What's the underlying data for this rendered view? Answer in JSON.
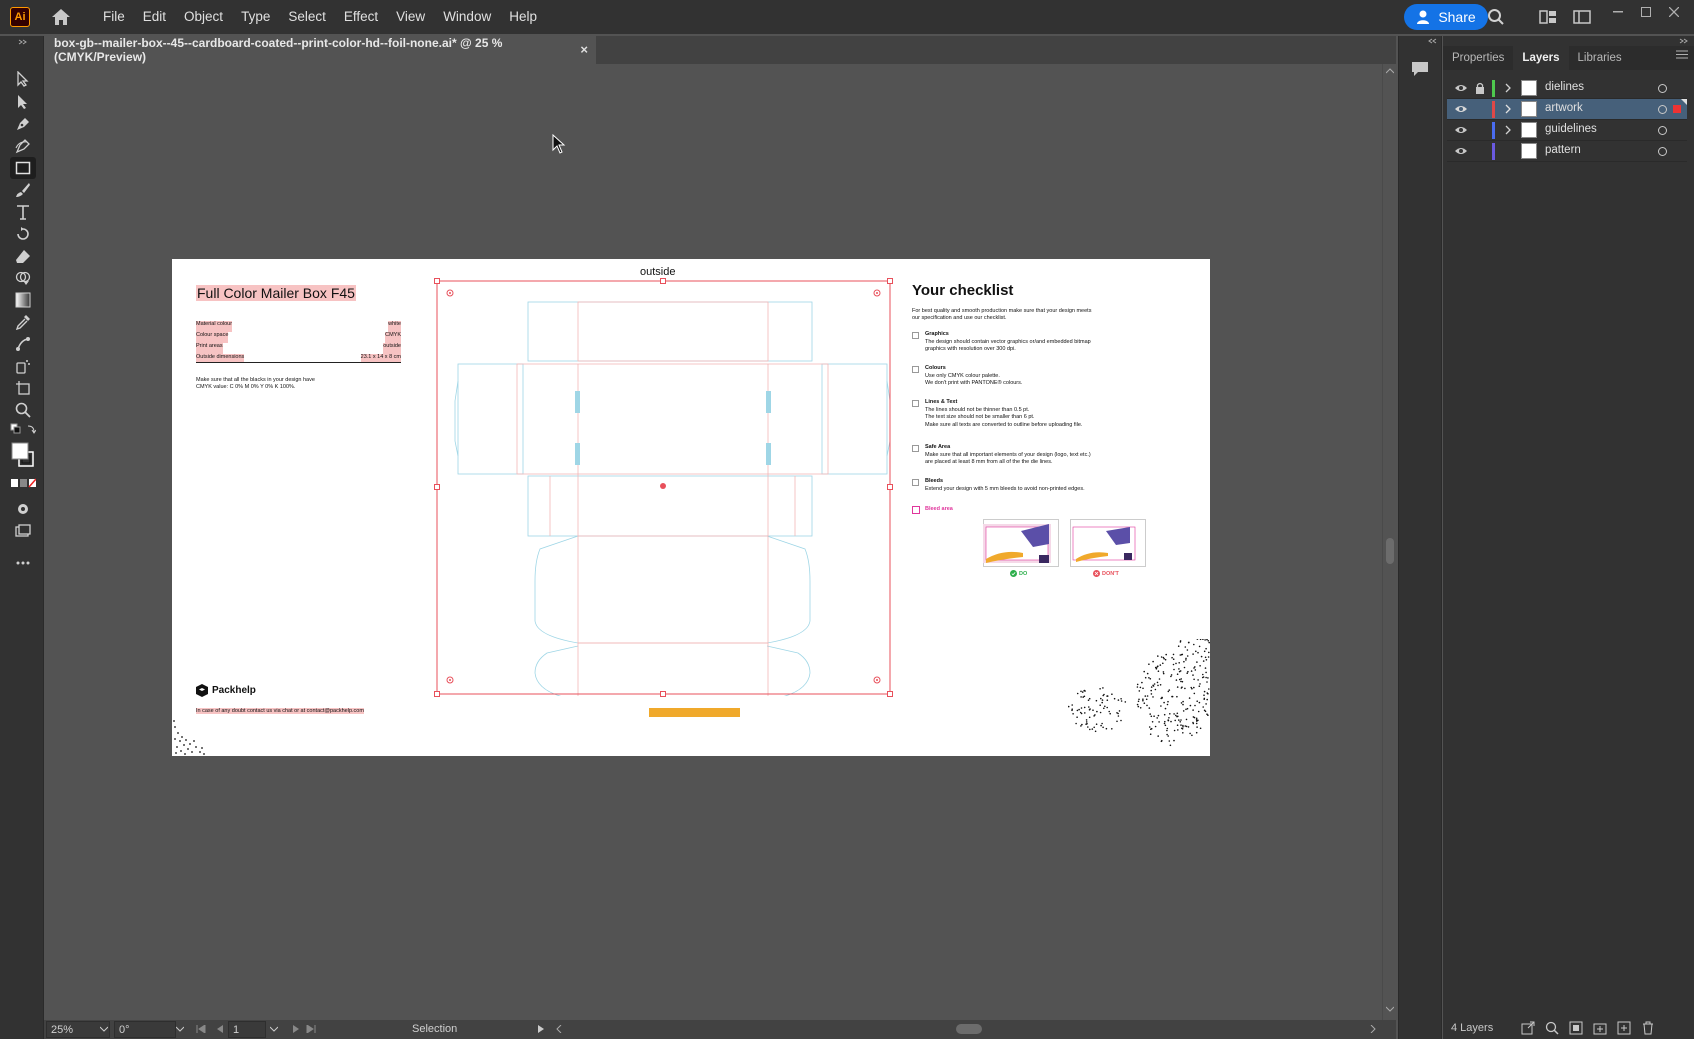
{
  "app": {
    "logo_label": "Ai",
    "menus": [
      "File",
      "Edit",
      "Object",
      "Type",
      "Select",
      "Effect",
      "View",
      "Window",
      "Help"
    ],
    "share_label": "Share"
  },
  "document": {
    "tab_title": "box-gb--mailer-box--45--cardboard-coated--print-color-hd--foil-none.ai* @ 25 % (CMYK/Preview)",
    "close_glyph": "×"
  },
  "artboard": {
    "side_label": "outside",
    "title": "Full Color Mailer Box F45",
    "specs": [
      {
        "key": "Material colour",
        "value": "white"
      },
      {
        "key": "Colour space",
        "value": "CMYK"
      },
      {
        "key": "Print areas",
        "value": "outside"
      },
      {
        "key": "Outside dimensions",
        "value": "23.1 x 14 x 8 cm"
      }
    ],
    "black_note_line1": "Make sure that all the blacks in your design have",
    "black_note_line2": "CMYK value: C 0% M 0% Y 0% K 100%.",
    "brand": "Packhelp",
    "contact": "In case of any doubt contact us via chat or at contact@packhelp.com",
    "checklist": {
      "heading": "Your checklist",
      "intro_line1": "For best quality and smooth production make sure that your design meets",
      "intro_line2": "our specification and use our checklist.",
      "items": [
        {
          "title": "Graphics",
          "lines": [
            "The design should contain vector graphics or/and embedded bitmap",
            "graphics with resolution over 300 dpi."
          ]
        },
        {
          "title": "Colours",
          "lines": [
            "Use only CMYK colour palette.",
            "We don't print with PANTONE® colours."
          ]
        },
        {
          "title": "Lines & Text",
          "lines": [
            "The lines should not be thinner than 0.5 pt.",
            "The text size should not be smaller than 6 pt.",
            "Make sure all texts are converted to outline before uploading file."
          ]
        },
        {
          "title": "Safe Area",
          "lines": [
            "Make sure that all important elements of your design (logo, text etc.)",
            "are placed at least 8 mm from all of the the die lines."
          ]
        },
        {
          "title": "Bleeds",
          "lines": [
            "Extend your design with 5 mm bleeds to avoid non-printed edges."
          ]
        }
      ],
      "bleed_label": "Bleed area",
      "do_label": "DO",
      "dont_label": "DON'T"
    }
  },
  "status": {
    "zoom": "25%",
    "rotation": "0°",
    "artboard_num": "1",
    "tool_name": "Selection"
  },
  "panel": {
    "tabs": [
      "Properties",
      "Layers",
      "Libraries"
    ],
    "active_tab": "Layers",
    "layers": [
      {
        "name": "dielines",
        "color": "#4ec94e",
        "locked": true,
        "expandable": true
      },
      {
        "name": "artwork",
        "color": "#e04848",
        "locked": false,
        "expandable": true,
        "selected": true
      },
      {
        "name": "guidelines",
        "color": "#4a6cf0",
        "locked": false,
        "expandable": true
      },
      {
        "name": "pattern",
        "color": "#6a5ae0",
        "locked": false,
        "expandable": false
      }
    ],
    "layer_count": "4 Layers"
  }
}
